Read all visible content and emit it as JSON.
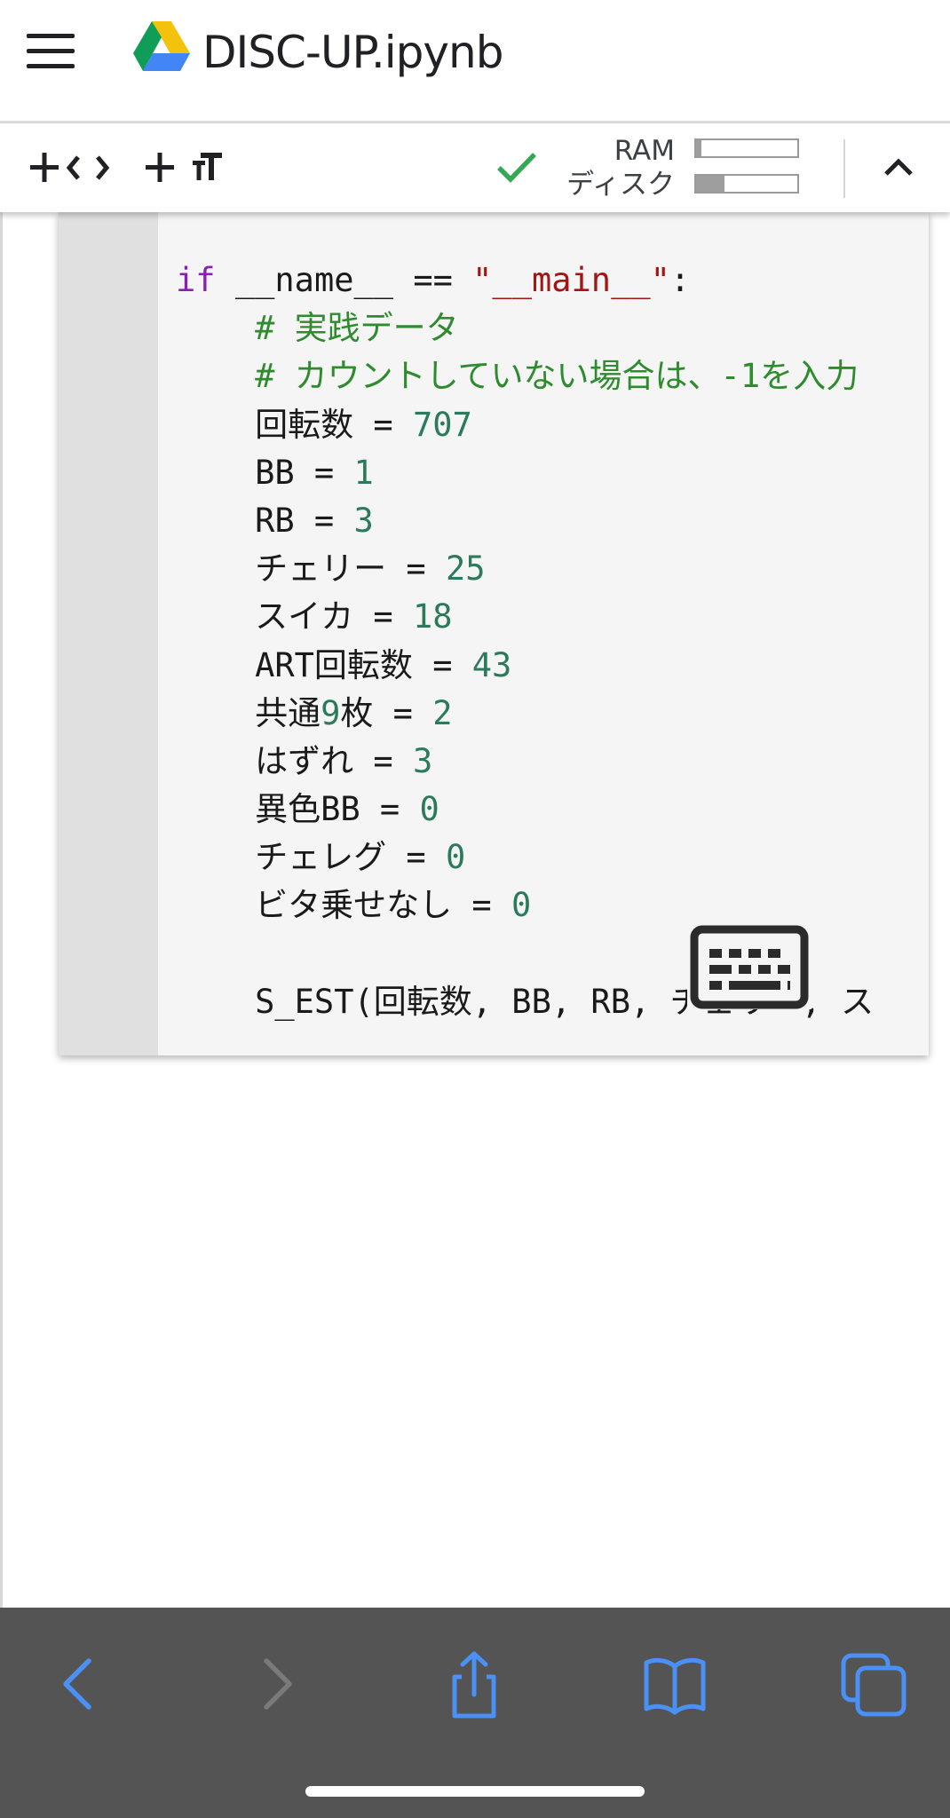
{
  "header": {
    "file_name": "DISC-UP.ipynb",
    "menu_icon": "hamburger-menu-icon",
    "logo_icon": "google-drive-icon"
  },
  "toolbar": {
    "add_code_label": "+ <>",
    "add_text_label": "+ TT",
    "status_icon": "check-icon",
    "ram_label": "RAM",
    "disk_label": "ディスク",
    "ram_usage_fraction": 0.05,
    "disk_usage_fraction": 0.28,
    "collapse_icon": "chevron-up-icon"
  },
  "code_cell": {
    "lines": [
      [
        {
          "t": "if",
          "c": "kw"
        },
        {
          "t": " __name__ == "
        },
        {
          "t": "\"__main__\"",
          "c": "str"
        },
        {
          "t": ":"
        }
      ],
      [
        {
          "t": "    "
        },
        {
          "t": "# 実践データ",
          "c": "cmt"
        }
      ],
      [
        {
          "t": "    "
        },
        {
          "t": "# カウントしていない場合は、-1を入力",
          "c": "cmt"
        }
      ],
      [
        {
          "t": "    回転数 = "
        },
        {
          "t": "707",
          "c": "num"
        }
      ],
      [
        {
          "t": "    BB = "
        },
        {
          "t": "1",
          "c": "num"
        }
      ],
      [
        {
          "t": "    RB = "
        },
        {
          "t": "3",
          "c": "num"
        }
      ],
      [
        {
          "t": "    チェリー = "
        },
        {
          "t": "25",
          "c": "num"
        }
      ],
      [
        {
          "t": "    スイカ = "
        },
        {
          "t": "18",
          "c": "num"
        }
      ],
      [
        {
          "t": "    ART回転数 = "
        },
        {
          "t": "43",
          "c": "num"
        }
      ],
      [
        {
          "t": "    共通"
        },
        {
          "t": "9",
          "c": "num"
        },
        {
          "t": "枚 = "
        },
        {
          "t": "2",
          "c": "num"
        }
      ],
      [
        {
          "t": "    はずれ = "
        },
        {
          "t": "3",
          "c": "num"
        }
      ],
      [
        {
          "t": "    異色BB = "
        },
        {
          "t": "0",
          "c": "num"
        }
      ],
      [
        {
          "t": "    チェレグ = "
        },
        {
          "t": "0",
          "c": "num"
        }
      ],
      [
        {
          "t": "    ビタ乗せなし = "
        },
        {
          "t": "0",
          "c": "num"
        }
      ],
      [
        {
          "t": ""
        }
      ],
      [
        {
          "t": "    S_EST(回転数, BB, RB, チェリー, ス"
        }
      ]
    ],
    "keyboard_icon": "keyboard-icon"
  },
  "bottom_bar": {
    "icons": [
      "back-icon",
      "forward-icon",
      "share-icon",
      "bookmarks-icon",
      "tabs-icon"
    ],
    "accent_color": "#4a90f5",
    "disabled_color": "#7a7a7a"
  }
}
